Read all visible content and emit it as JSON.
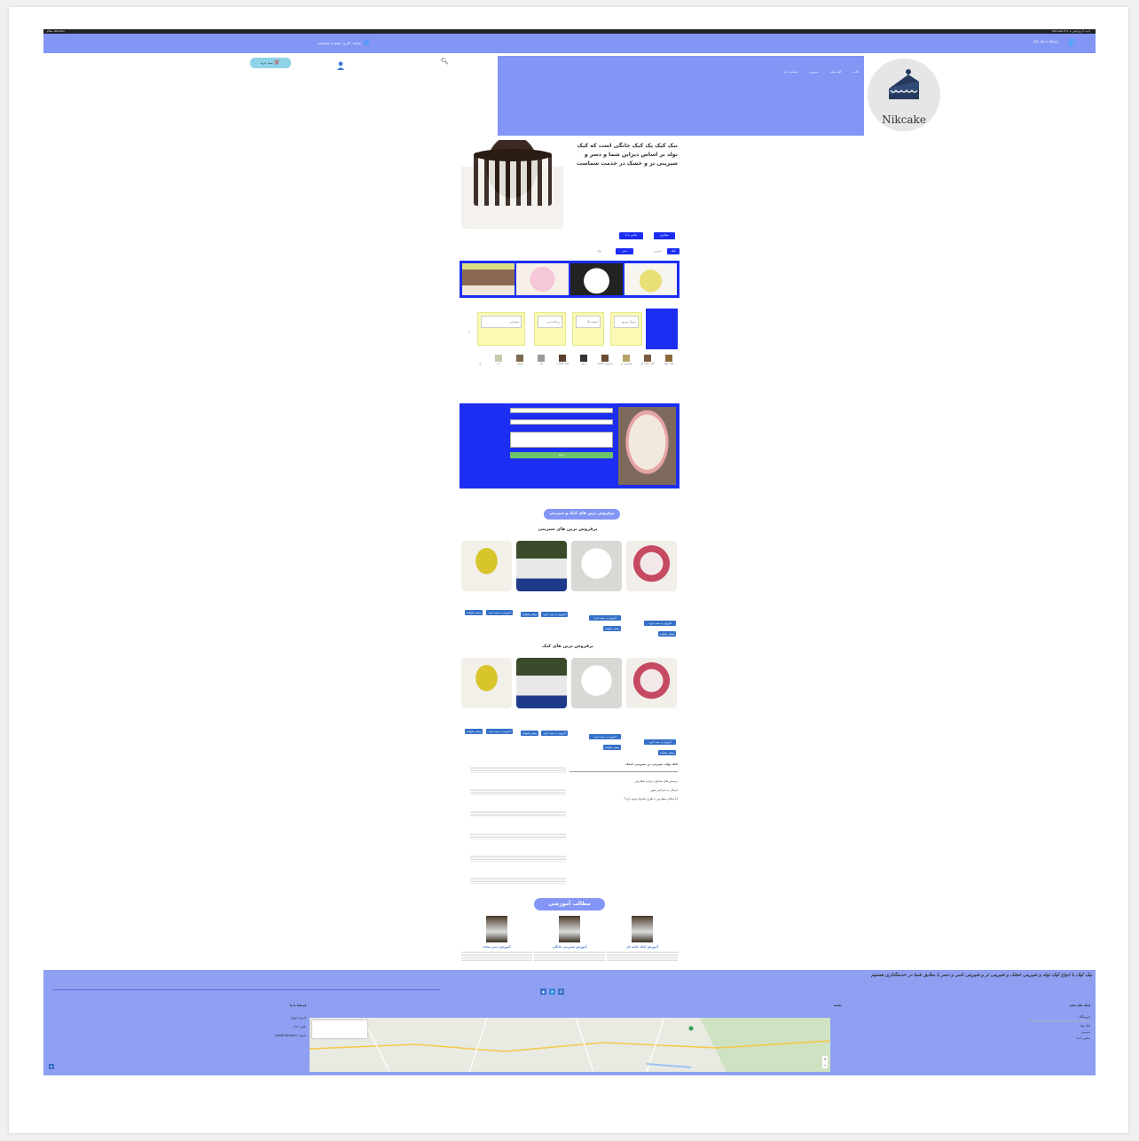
{
  "adminbar": {
    "left": "Nikcake ✉ 1 ＋ جدید ✎ ویرایش",
    "right": "سلام، Nikcake"
  },
  "topbar": {
    "phone_icon": "phone-icon",
    "contact_text": "ارتباط با نیک کیک",
    "date_icon": "calendar-icon",
    "date_text": "ساعت کاری: شنبه تا پنجشنبه"
  },
  "header": {
    "nav": [
      "خانه",
      "کیک تولد",
      "شیرینی",
      "تماس با ما"
    ],
    "search_icon": "search-icon",
    "user_icon": "user-icon",
    "cart_label": "سبد خرید",
    "logo_text": "Nikcake"
  },
  "hero": {
    "text": "نیک کیک یک کیک خانگی است که کیک تولد بر اساس دیزاین شما و دسر و شیرینی تر و خشک در خدمت شماست",
    "buttons": [
      "سفارش",
      "تماس با ما"
    ],
    "tags": [
      "کیک",
      "شیرینی",
      "دسر",
      "تولد"
    ]
  },
  "features": [
    "ارسال سریع",
    "کیفیت بالا",
    "پرداخت امن",
    "پشتیبانی"
  ],
  "categories": [
    "کیک تولد",
    "کیک خامه ای",
    "شیرینی تر",
    "شیرینی خشک",
    "دسر",
    "کیک فنجانی",
    "ژله",
    "کوکی",
    "نان"
  ],
  "contact_form": {
    "submit_label": "ارسال"
  },
  "bestsellers": {
    "pill": "پرفروش ترین های کیک و شیرینی",
    "sweets_title": "پرفروش ترین های شیرینی",
    "cakes_title": "پرفروش ترین های کیک",
    "add_label": "افزودن به سبد خرید",
    "more_label": "بیشتر بخوانید"
  },
  "faq": {
    "title": "کیک تولد، شیرینی تر، شیرینی خشک",
    "lines": [
      "پرسش های متداول درباره سفارش",
      "ارسال به سراسر شهر",
      "آیا امکان سفارش با طرح دلخواه وجود دارد؟"
    ]
  },
  "articles": {
    "pill": "مطالب آموزشی",
    "items": [
      {
        "title": "آموزش کیک خامه ای"
      },
      {
        "title": "آموزش شیرینی خانگی"
      },
      {
        "title": "آموزش دسر ساده"
      }
    ]
  },
  "footer": {
    "tagline": "نیک کیک با انواع کیک تولد و شیرینی خشک و شیرینی تر و شیرینی نامی و دسر با سلایق شما در خدمتگذاری هستیم",
    "col_links_title": "لینک های مفید",
    "links": [
      "فروشگاه",
      "کیک تولد",
      "شیرینی",
      "تماس با ما"
    ],
    "col_map_title": "نقشه",
    "col_contact_title": "ارتباط با ما",
    "contact_lines": [
      "آدرس: تهران",
      "تلفن: ۰۹۱۲",
      "ایمیل: info@nikcake.ir"
    ],
    "social": [
      "instagram-icon",
      "telegram-icon",
      "whatsapp-icon"
    ]
  },
  "colors": {
    "brand": "#8395f5",
    "blue": "#1b2ef2",
    "button": "#3571c9",
    "feature": "#fafab4"
  }
}
